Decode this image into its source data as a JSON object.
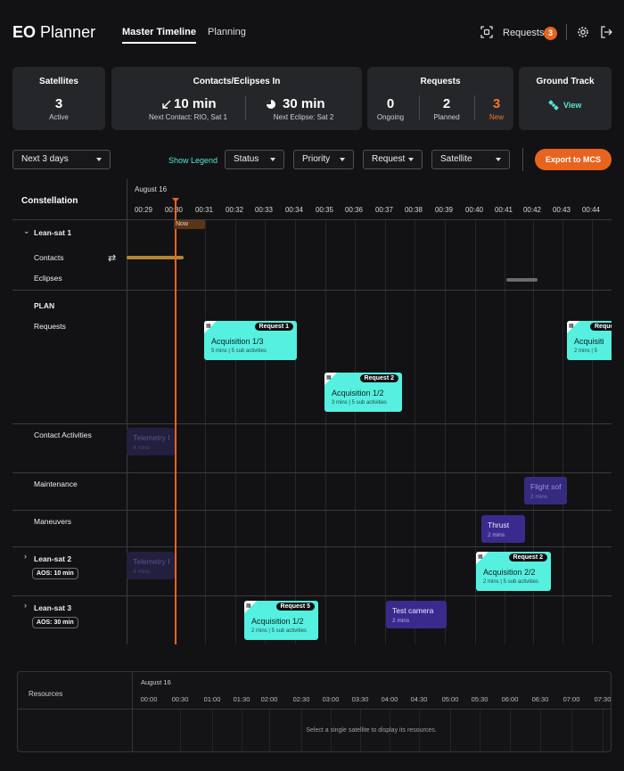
{
  "header": {
    "logo_bold": "EO",
    "logo_rest": "Planner",
    "tabs": [
      "Master Timeline",
      "Planning"
    ],
    "requests_label": "Requests",
    "requests_count": "3"
  },
  "summary": {
    "satellites": {
      "title": "Satellites",
      "value": "3",
      "label": "Active"
    },
    "contacts": {
      "title": "Contacts/Eclipses In",
      "contact_value": "10 min",
      "contact_label": "Next Contact: RIO, Sat 1",
      "eclipse_value": "30 min",
      "eclipse_label": "Next Eclipse: Sat 2"
    },
    "requests": {
      "title": "Requests",
      "ongoing": "0",
      "ongoing_label": "Ongoing",
      "planned": "2",
      "planned_label": "Planned",
      "new": "3",
      "new_label": "New"
    },
    "ground_track": {
      "title": "Ground Track",
      "link": "View"
    }
  },
  "toolbar": {
    "range": "Next 3 days",
    "show_legend": "Show Legend",
    "status": "Status",
    "priority": "Priority",
    "request": "Request",
    "satellite": "Satellite",
    "export": "Export to MCS"
  },
  "timeline": {
    "title": "Constellation",
    "date": "August 16",
    "ticks": [
      "00:29",
      "00:30",
      "00:31",
      "00:32",
      "00:33",
      "00:34",
      "00:35",
      "00:36",
      "00:37",
      "00:38",
      "00:39",
      "00:40",
      "00:41",
      "00:42",
      "00:43",
      "00:44"
    ],
    "now_label": "Now",
    "rows": {
      "sat1": "Lean-sat 1",
      "contacts": "Contacts",
      "eclipses": "Eclipses",
      "plan": "PLAN",
      "requests": "Requests",
      "contact_activities": "Contact Activities",
      "maintenance": "Maintenance",
      "maneuvers": "Maneuvers",
      "sat2": "Lean-sat 2",
      "sat2_aos": "AOS: 10 min",
      "sat3": "Lean-sat 3",
      "sat3_aos": "AOS: 30 min"
    },
    "requests": [
      {
        "tag": "Request 1",
        "name": "Acquisition 1/3",
        "detail": "5 mins | 5 sub activities"
      },
      {
        "tag": "Request 2",
        "name": "Acquisition 1/2",
        "detail": "3 mins | 5 sub activities"
      },
      {
        "tag": "Reque",
        "name": "Acquisiti",
        "detail": "2 mins | 5"
      },
      {
        "tag": "Request 2",
        "name": "Acquisition 2/2",
        "detail": "2 mins | 5 sub activities"
      },
      {
        "tag": "Request 5",
        "name": "Acquisition 1/2",
        "detail": "2 mins | 5 sub activities"
      }
    ],
    "activities": [
      {
        "name": "Telemetry I",
        "detail": "4 mins"
      },
      {
        "name": "Flight sof",
        "detail": "2 mins"
      },
      {
        "name": "Thrust",
        "detail": "2 mins"
      },
      {
        "name": "Telemetry I",
        "detail": "4 mins"
      },
      {
        "name": "Test camera",
        "detail": "2 mins"
      }
    ]
  },
  "resources": {
    "label": "Resources",
    "date": "August 16",
    "ticks": [
      "00:00",
      "00:30",
      "01:00",
      "01:30",
      "02:00",
      "02:30",
      "03:00",
      "03:30",
      "04:00",
      "04:30",
      "05:00",
      "05:30",
      "06:00",
      "06:30",
      "07:00",
      "07:30"
    ],
    "message": "Select a single satellite to display its resources."
  },
  "colors": {
    "accent": "#e8641e",
    "request_card": "#55f0e0",
    "activity": "#3b2a8e",
    "background": "#121214"
  }
}
